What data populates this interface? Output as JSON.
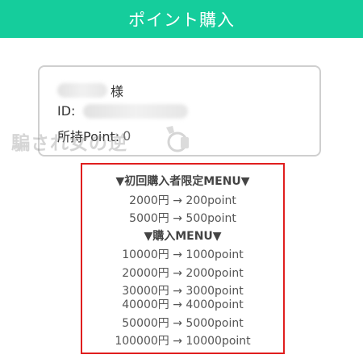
{
  "header": {
    "title": "ポイント購入"
  },
  "account": {
    "name_suffix": "様",
    "id_label": "ID:",
    "points_label": "所持Point:",
    "points_value": "0"
  },
  "watermark": {
    "text": "騙され女の逆"
  },
  "menu": {
    "first_heading": "▼初回購入者限定MENU▼",
    "first_items": [
      "2000円 → 200point",
      "5000円 → 500point"
    ],
    "purchase_heading": "▼購入MENU▼",
    "purchase_items": [
      "10000円 → 1000point",
      "20000円 → 2000point",
      "30000円 → 3000point",
      "40000円 → 4000point",
      "50000円 → 5000point",
      "100000円 → 10000point"
    ]
  },
  "colors": {
    "header_bg": "#15cd9c",
    "menu_border": "#e01e1e",
    "card_border": "#cfcfcf"
  }
}
